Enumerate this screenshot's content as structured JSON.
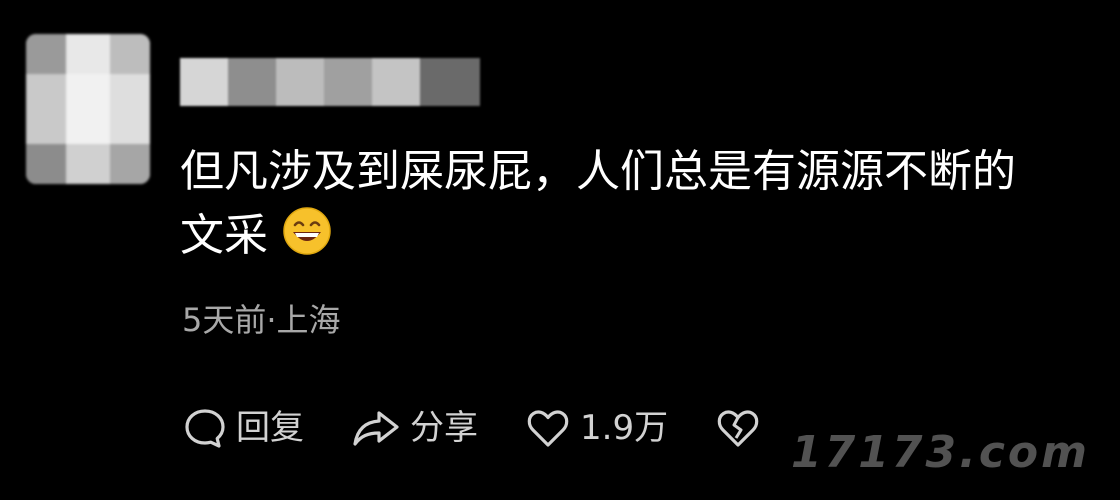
{
  "comment": {
    "text_line_1": "但凡涉及到屎尿屁，人们总是有源源不断的",
    "text_line_2": "文采",
    "emoji_name": "grinning-face",
    "meta": "5天前·上海"
  },
  "actions": {
    "reply_label": "回复",
    "share_label": "分享",
    "like_count": "1.9万"
  },
  "watermark": "17173.com",
  "colors": {
    "background": "#000000",
    "text": "#ffffff",
    "meta": "#a8a8a8",
    "action": "#d2d2d2",
    "emoji": "#f7c12b"
  }
}
